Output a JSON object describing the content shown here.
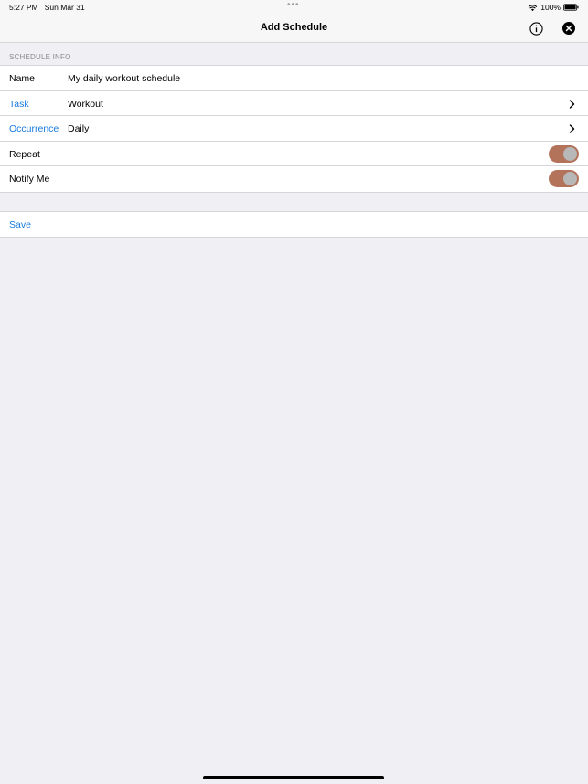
{
  "status_bar": {
    "time": "5:27 PM",
    "date": "Sun Mar 31",
    "dots": "•••",
    "battery": "100%"
  },
  "nav": {
    "title": "Add Schedule",
    "info_icon": "info-circle-icon",
    "close_icon": "close-circle-icon"
  },
  "section": {
    "header": "SCHEDULE INFO"
  },
  "form": {
    "name_label": "Name",
    "name_value": "My daily workout schedule",
    "task_label": "Task",
    "task_value": "Workout",
    "occurrence_label": "Occurrence",
    "occurrence_value": "Daily",
    "repeat_label": "Repeat",
    "repeat_on": true,
    "notify_label": "Notify Me",
    "notify_on": true
  },
  "actions": {
    "save_label": "Save"
  },
  "colors": {
    "accent": "#1a7be0",
    "toggle_on": "#b2735a",
    "background": "#efeff4"
  }
}
